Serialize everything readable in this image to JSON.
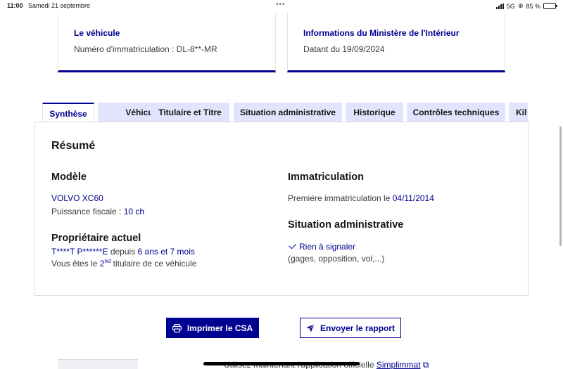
{
  "status_bar": {
    "time": "11:00",
    "date": "Samedi 21 septembre",
    "network": "5G",
    "battery": "85 %",
    "battery_level": 0.85
  },
  "cards": [
    {
      "title": "Le véhicule",
      "text": "Numéro d'immatriculation : DL-8**-MR"
    },
    {
      "title": "Informations du Ministère de l'Intérieur",
      "text": "Datant du 19/09/2024"
    }
  ],
  "tabs": [
    {
      "label": "Synthèse",
      "active": true
    },
    {
      "label": "Véhicule"
    },
    {
      "label": "Titulaire et Titre"
    },
    {
      "label": "Situation administrative"
    },
    {
      "label": "Historique"
    },
    {
      "label": "Contrôles techniques"
    },
    {
      "label": "Kil"
    }
  ],
  "summary": {
    "heading": "Résumé",
    "model": {
      "heading": "Modèle",
      "name": "VOLVO XC60",
      "fiscal_label": "Puissance fiscale : ",
      "fiscal_value": "10 ch"
    },
    "owner": {
      "heading": "Propriétaire actuel",
      "name": "T****T P******E",
      "since_label": " depuis ",
      "since_value": "6 ans et 7 mois",
      "rank_prefix": "Vous êtes le ",
      "rank_number": "2",
      "rank_suffix": "nd",
      "rank_rest": " titulaire de ce véhicule"
    },
    "registration": {
      "heading": "Immatriculation",
      "label": "Première immatriculation le ",
      "date": "04/11/2014"
    },
    "admin": {
      "heading": "Situation administrative",
      "status": "Rien à signaler",
      "detail": "(gages, opposition, vol,...)"
    }
  },
  "buttons": {
    "print": "Imprimer le CSA",
    "send": "Envoyer le rapport"
  },
  "footer": {
    "text_prefix": "Utilisez maintenant l'application officielle ",
    "app_link": "Simplimmat"
  },
  "colors": {
    "accent": "#000091",
    "tab_inactive": "#e3e3fd"
  }
}
